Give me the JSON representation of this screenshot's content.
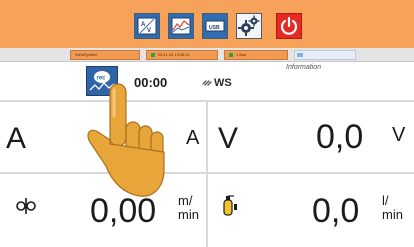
{
  "toolbar": {
    "buttons": [
      {
        "name": "av-display",
        "icon": "av-display-icon"
      },
      {
        "name": "graph",
        "icon": "graph-icon"
      },
      {
        "name": "usb",
        "icon": "usb-icon"
      },
      {
        "name": "settings",
        "icon": "gears-icon"
      },
      {
        "name": "power",
        "icon": "power-icon"
      }
    ],
    "usb_label": "USB"
  },
  "status": {
    "mode": "WeldSystem",
    "datetime": "08.11.23 13:08:01",
    "program": "1 Bas",
    "progress": 0.1
  },
  "info": {
    "rec_label": "rec",
    "time": "00:00",
    "ws_label": "WS",
    "information_label": "Information"
  },
  "measurements": {
    "current": {
      "label": "A",
      "value": "",
      "unit": "A"
    },
    "voltage": {
      "label": "V",
      "value": "0,0",
      "unit": "V"
    },
    "wire_speed": {
      "value": "0,00",
      "unit_top": "m/",
      "unit_bottom": "min"
    },
    "gas_flow": {
      "value": "0,0",
      "unit_top": "l/",
      "unit_bottom": "min"
    }
  },
  "colors": {
    "toolbar": "#f6a25a",
    "button_blue": "#2f6db0",
    "power_red": "#e42a22",
    "status_ok": "#2ca244",
    "hand": "#e8a53a"
  }
}
